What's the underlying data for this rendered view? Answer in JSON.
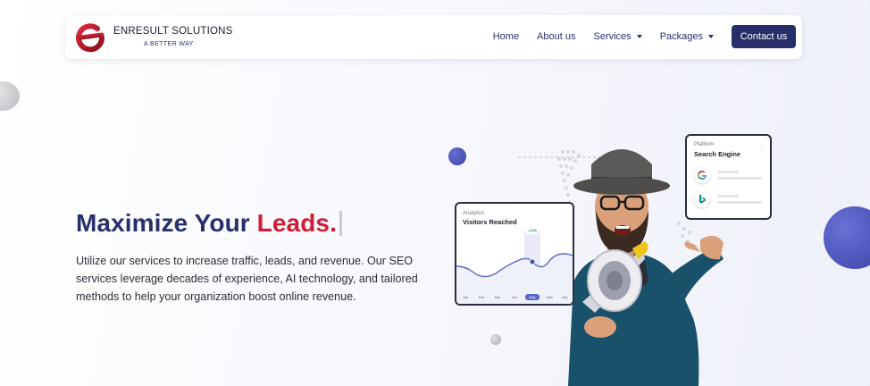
{
  "brand": {
    "name": "ENRESULT SOLUTIONS",
    "tagline": "A BETTER WAY",
    "logo_letter": "e",
    "colors": {
      "primary": "#272f6a",
      "accent": "#d01c35"
    }
  },
  "nav": {
    "home": "Home",
    "about": "About us",
    "services": "Services",
    "packages": "Packages",
    "contact": "Contact us"
  },
  "hero": {
    "title_main": "Maximize Your ",
    "title_accent": "Leads.",
    "description": "Utilize our services to increase traffic, leads, and revenue. Our SEO services leverage decades of experience, AI technology, and tailored methods to help your organization boost online revenue."
  },
  "analytics_card": {
    "subtitle": "Analytics",
    "title": "Visitors Reached",
    "badge": "+4%",
    "months": [
      "Jan",
      "Feb",
      "Mar",
      "Apr",
      "May",
      "June",
      "July"
    ],
    "highlighted_month": "May"
  },
  "platform_card": {
    "subtitle": "Platform",
    "title": "Search Engine",
    "icons": [
      "google-icon",
      "bing-icon"
    ]
  }
}
